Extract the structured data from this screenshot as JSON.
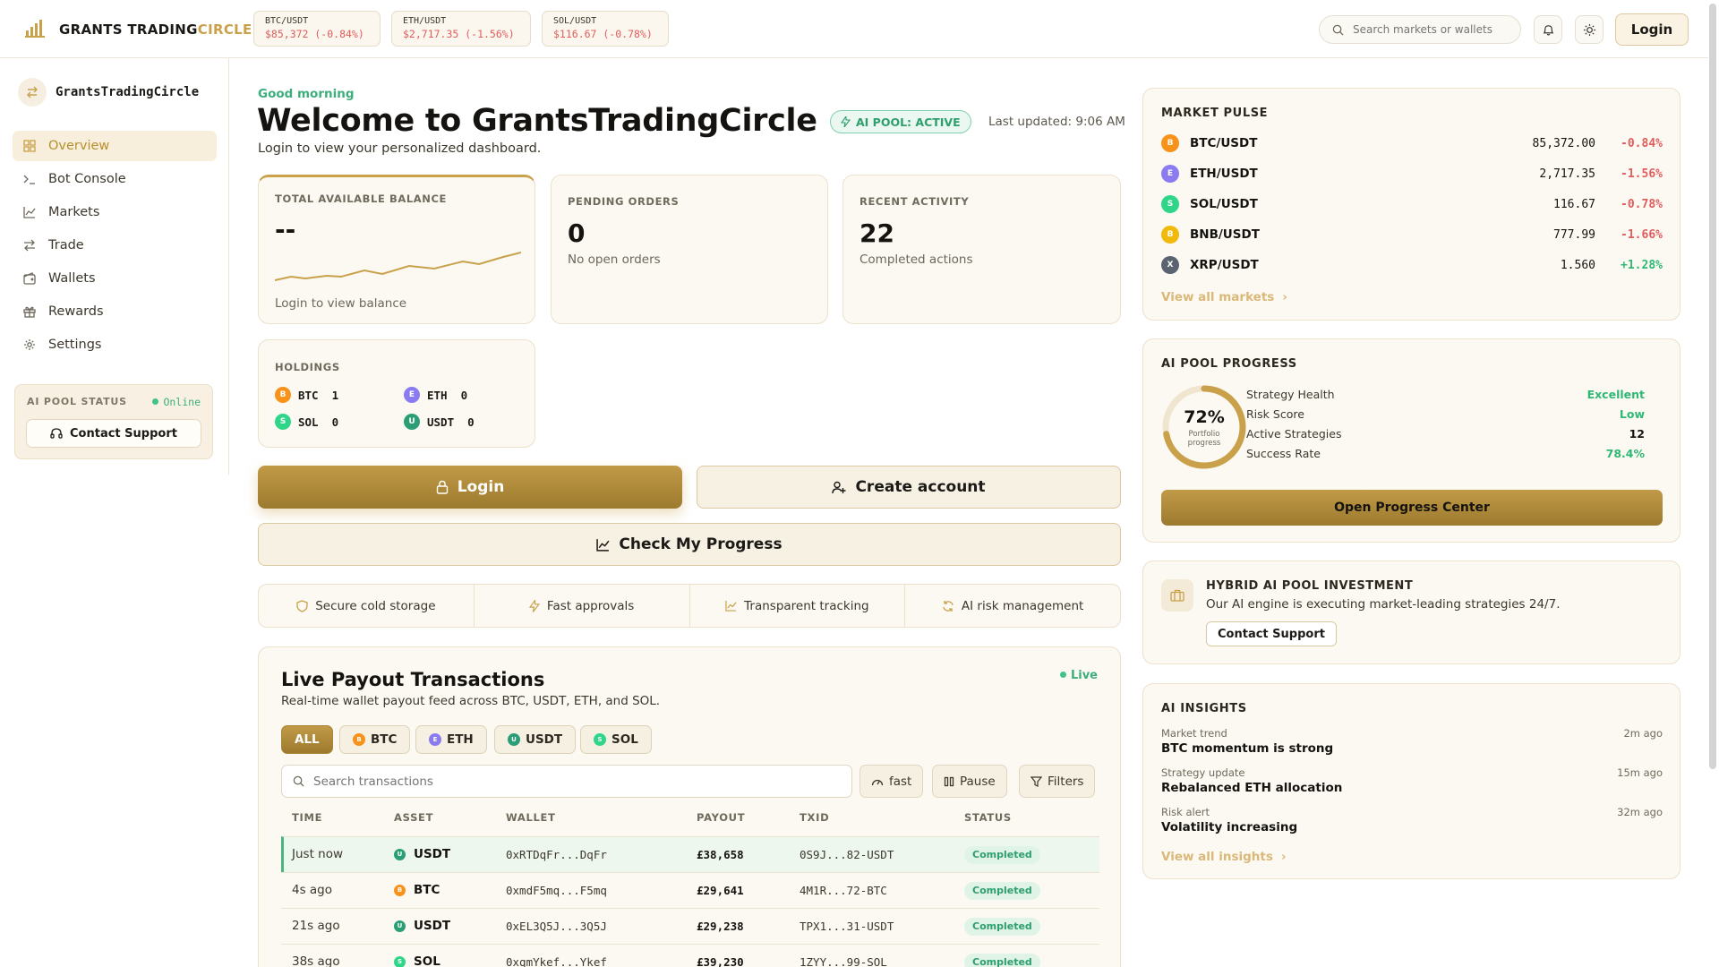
{
  "brand": {
    "name_main": "GRANTS TRADING",
    "name_accent": "CIRCLE"
  },
  "tickers": [
    {
      "symbol": "BTC/USDT",
      "value": "$85,372 (-0.84%)"
    },
    {
      "symbol": "ETH/USDT",
      "value": "$2,717.35 (-1.56%)"
    },
    {
      "symbol": "SOL/USDT",
      "value": "$116.67 (-0.78%)"
    }
  ],
  "header": {
    "search_placeholder": "Search markets or wallets",
    "login_label": "Login"
  },
  "sidebar": {
    "title": "GrantsTradingCircle",
    "items": [
      {
        "label": "Overview",
        "icon": "grid-icon",
        "active": true
      },
      {
        "label": "Bot Console",
        "icon": "terminal-icon"
      },
      {
        "label": "Markets",
        "icon": "chart-line-icon"
      },
      {
        "label": "Trade",
        "icon": "swap-icon"
      },
      {
        "label": "Wallets",
        "icon": "wallet-icon"
      },
      {
        "label": "Rewards",
        "icon": "gift-icon"
      },
      {
        "label": "Settings",
        "icon": "gear-icon"
      }
    ],
    "pool_status": {
      "label": "AI POOL STATUS",
      "status": "Online",
      "contact_label": "Contact Support"
    }
  },
  "main": {
    "greeting": "Good morning",
    "title": "Welcome to GrantsTradingCircle",
    "subtitle": "Login to view your personalized dashboard.",
    "ai_pool_badge": "AI POOL: ACTIVE",
    "last_updated": "Last updated: 9:06 AM",
    "balance": {
      "label": "TOTAL AVAILABLE BALANCE",
      "value": "--",
      "note": "Login to view balance"
    },
    "pending": {
      "label": "PENDING ORDERS",
      "value": "0",
      "note": "No open orders"
    },
    "activity": {
      "label": "RECENT ACTIVITY",
      "value": "22",
      "note": "Completed actions"
    },
    "holdings": {
      "label": "HOLDINGS",
      "items": [
        {
          "symbol": "BTC",
          "amount": "1",
          "badge": "B",
          "color": "#f7931a"
        },
        {
          "symbol": "ETH",
          "amount": "0",
          "badge": "E",
          "color": "#8a7cf0"
        },
        {
          "symbol": "SOL",
          "amount": "0",
          "badge": "S",
          "color": "#2fd68a"
        },
        {
          "symbol": "USDT",
          "amount": "0",
          "badge": "U",
          "color": "#2b9e76"
        }
      ]
    },
    "buttons": {
      "login": "Login",
      "create_account": "Create account",
      "check_progress": "Check My Progress"
    },
    "features": [
      "Secure cold storage",
      "Fast approvals",
      "Transparent tracking",
      "AI risk management"
    ]
  },
  "payouts": {
    "title": "Live Payout Transactions",
    "subtitle": "Real-time wallet payout feed across BTC, USDT, ETH, and SOL.",
    "live_label": "Live",
    "filters": [
      "ALL",
      "BTC",
      "ETH",
      "USDT",
      "SOL"
    ],
    "search_placeholder": "Search transactions",
    "speed_label": "fast",
    "pause_label": "Pause",
    "filters_label": "Filters",
    "columns": [
      "TIME",
      "ASSET",
      "WALLET",
      "PAYOUT",
      "TXID",
      "STATUS"
    ],
    "rows": [
      {
        "time": "Just now",
        "asset": "USDT",
        "wallet": "0xRTDqFr...DqFr",
        "payout": "£38,658",
        "txid": "0S9J...82-USDT",
        "status": "Completed"
      },
      {
        "time": "4s ago",
        "asset": "BTC",
        "wallet": "0xmdF5mq...F5mq",
        "payout": "£29,641",
        "txid": "4M1R...72-BTC",
        "status": "Completed"
      },
      {
        "time": "21s ago",
        "asset": "USDT",
        "wallet": "0xEL3Q5J...3Q5J",
        "payout": "£29,238",
        "txid": "TPX1...31-USDT",
        "status": "Completed"
      },
      {
        "time": "38s ago",
        "asset": "SOL",
        "wallet": "0xqmYkef...Ykef",
        "payout": "£39,230",
        "txid": "1ZYY...99-SOL",
        "status": "Completed"
      }
    ]
  },
  "market_pulse": {
    "label": "MARKET PULSE",
    "rows": [
      {
        "pair": "BTC/USDT",
        "price": "85,372.00",
        "change": "-0.84%",
        "badge": "B",
        "color": "#f7931a",
        "up": false
      },
      {
        "pair": "ETH/USDT",
        "price": "2,717.35",
        "change": "-1.56%",
        "badge": "E",
        "color": "#8a7cf0",
        "up": false
      },
      {
        "pair": "SOL/USDT",
        "price": "116.67",
        "change": "-0.78%",
        "badge": "S",
        "color": "#2fd68a",
        "up": false
      },
      {
        "pair": "BNB/USDT",
        "price": "777.99",
        "change": "-1.66%",
        "badge": "B",
        "color": "#f0b90b",
        "up": false
      },
      {
        "pair": "XRP/USDT",
        "price": "1.560",
        "change": "+1.28%",
        "badge": "X",
        "color": "#5b6370",
        "up": true
      }
    ],
    "view_all": "View all markets"
  },
  "ai_progress": {
    "label": "AI POOL PROGRESS",
    "percent": "72%",
    "percent_value": 72,
    "ring_caption": "Portfolio progress",
    "metrics": [
      {
        "name": "Strategy Health",
        "value": "Excellent",
        "color": "#2fb874"
      },
      {
        "name": "Risk Score",
        "value": "Low",
        "color": "#2fb874"
      },
      {
        "name": "Active Strategies",
        "value": "12",
        "color": "#15130f"
      },
      {
        "name": "Success Rate",
        "value": "78.4%",
        "color": "#2fb874"
      }
    ],
    "button": "Open Progress Center"
  },
  "hybrid": {
    "title": "HYBRID AI POOL INVESTMENT",
    "text": "Our AI engine is executing market-leading strategies 24/7.",
    "button": "Contact Support"
  },
  "insights": {
    "label": "AI INSIGHTS",
    "items": [
      {
        "kind": "Market trend",
        "text": "BTC momentum is strong",
        "time": "2m ago"
      },
      {
        "kind": "Strategy update",
        "text": "Rebalanced ETH allocation",
        "time": "15m ago"
      },
      {
        "kind": "Risk alert",
        "text": "Volatility increasing",
        "time": "32m ago"
      }
    ],
    "view_all": "View all insights"
  },
  "colors": {
    "accent": "#c9a14a",
    "positive": "#2fb874",
    "negative": "#e05d5d"
  }
}
